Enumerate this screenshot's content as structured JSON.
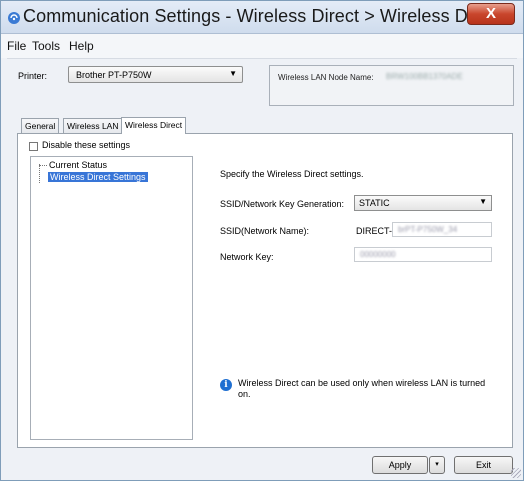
{
  "window": {
    "title": "Communication Settings - Wireless Direct > Wireless Di...",
    "close_label": "X"
  },
  "menu": {
    "items": [
      "File",
      "Tools",
      "Help"
    ]
  },
  "printer": {
    "label": "Printer:",
    "selected": "Brother PT-P750W"
  },
  "node": {
    "label": "Wireless LAN Node Name:",
    "value": "BRW100BB1370ADE"
  },
  "tabs": [
    "General",
    "Wireless LAN",
    "Wireless Direct"
  ],
  "disable": {
    "label": "Disable these settings",
    "checked": false
  },
  "tree": {
    "items": [
      "Current Status",
      "Wireless Direct Settings"
    ]
  },
  "settings": {
    "heading": "Specify the Wireless Direct settings.",
    "ssid_key_gen_label": "SSID/Network Key Generation:",
    "ssid_key_gen_value": "STATIC",
    "ssid_label": "SSID(Network Name):",
    "ssid_prefix": "DIRECT-",
    "ssid_value": "brPT-P750W_34",
    "network_key_label": "Network Key:",
    "network_key_value": "00000000"
  },
  "info": {
    "text": "Wireless Direct can be used only when wireless LAN is turned on."
  },
  "buttons": {
    "apply": "Apply",
    "apply_drop": "▾",
    "exit": "Exit"
  },
  "colors": {
    "selection": "#3875d7",
    "info_icon": "#1f6fd1",
    "close_button": "#c9462c"
  }
}
